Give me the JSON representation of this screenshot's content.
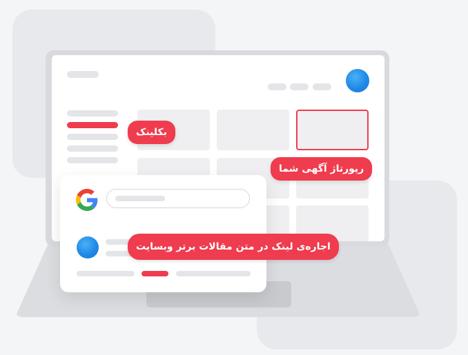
{
  "labels": {
    "backlink": "بکلینک",
    "reportage": "رپورتاژ آگهی شما",
    "link_rent": "اجاره‌ی لینک در متن مقالات برتر وبسایت"
  },
  "icons": {
    "brand": "google-logo-icon",
    "avatar": "blue-avatar-icon"
  },
  "colors": {
    "accent": "#ef3c4e",
    "avatar": "#1f8ae6",
    "background": "#f4f5f7",
    "placeholder": "#e4e5e8"
  }
}
